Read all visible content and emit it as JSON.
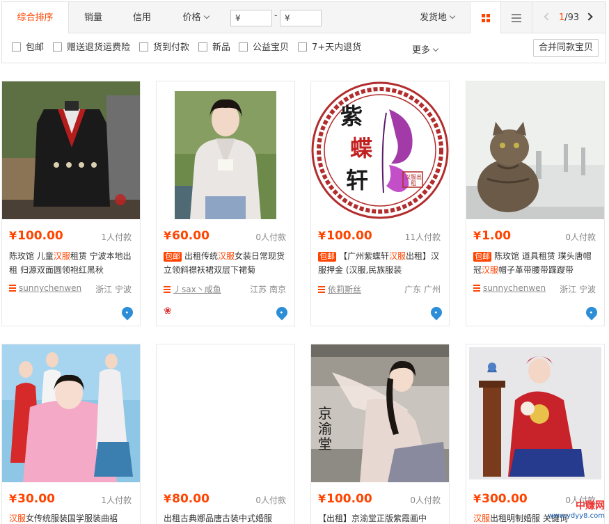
{
  "sort": {
    "tabs": [
      {
        "label": "综合排序",
        "active": true
      },
      {
        "label": "销量",
        "active": false
      },
      {
        "label": "信用",
        "active": false
      },
      {
        "label": "价格",
        "active": false
      }
    ],
    "price_min_placeholder": "¥",
    "price_max_placeholder": "¥",
    "price_dash": "-",
    "ship_from": "发货地",
    "page_current": "1",
    "page_total": "/93"
  },
  "filters": {
    "items": [
      "包邮",
      "赠送退货运费险",
      "货到付款",
      "新品",
      "公益宝贝",
      "7+天内退货"
    ],
    "more": "更多",
    "merge_button": "合并同款宝贝"
  },
  "products": [
    {
      "price_yen": "¥",
      "price": "100.00",
      "deals": "1人付款",
      "baoyou": "",
      "title_pre": "陈玫馆 儿童",
      "title_hl": "汉服",
      "title_post": "租赁 宁波本地出租 归源双面圆领袍红黑秋",
      "shop": "sunnychenwen",
      "location": "浙江 宁波"
    },
    {
      "price_yen": "¥",
      "price": "60.00",
      "deals": "0人付款",
      "baoyou": "包邮",
      "title_pre": "出租传统",
      "title_hl": "汉服",
      "title_post": "女装日常现货立领斜襟袄裙双层下裙菊",
      "shop": "丿sax丶咸鱼",
      "location": "江苏 南京"
    },
    {
      "price_yen": "¥",
      "price": "100.00",
      "deals": "11人付款",
      "baoyou": "包邮",
      "title_pre": "【广州紫蝶轩",
      "title_hl": "汉服",
      "title_post": "出租】汉服押金 (汉服,民族服装",
      "shop": "依莉斯丝",
      "location": "广东 广州"
    },
    {
      "price_yen": "¥",
      "price": "1.00",
      "deals": "0人付款",
      "baoyou": "包邮",
      "title_pre": "陈玫馆 道具租赁 璞头唐帽冠",
      "title_hl": "汉服",
      "title_post": "帽子革带腰带蹀躞带",
      "shop": "sunnychenwen",
      "location": "浙江 宁波"
    },
    {
      "price_yen": "¥",
      "price": "30.00",
      "deals": "1人付款",
      "baoyou": "",
      "title_pre": "",
      "title_hl": "汉服",
      "title_post": "女传统服装国学服装曲裾",
      "shop": "",
      "location": ""
    },
    {
      "price_yen": "¥",
      "price": "80.00",
      "deals": "0人付款",
      "baoyou": "",
      "title_pre": "出租古典娜品唐古装中式婚服",
      "title_hl": "",
      "title_post": "",
      "shop": "",
      "location": ""
    },
    {
      "price_yen": "¥",
      "price": "100.00",
      "deals": "0人付款",
      "baoyou": "",
      "title_pre": "【出租】京渝堂正版紫霞画中",
      "title_hl": "",
      "title_post": "",
      "shop": "",
      "location": ""
    },
    {
      "price_yen": "¥",
      "price": "300.00",
      "deals": "0人付款",
      "baoyou": "",
      "title_pre": "",
      "title_hl": "汉服",
      "title_post": "出租明制婚服 关键词",
      "shop": "",
      "location": ""
    }
  ],
  "card3_logo": {
    "line1": "紫",
    "line2": "蝶",
    "line3": "轩",
    "seal": "汉服出租"
  },
  "card7_calligraphy": "京渝堂",
  "watermark": {
    "big": "中赚网",
    "small": "www.ydyy8.com"
  }
}
